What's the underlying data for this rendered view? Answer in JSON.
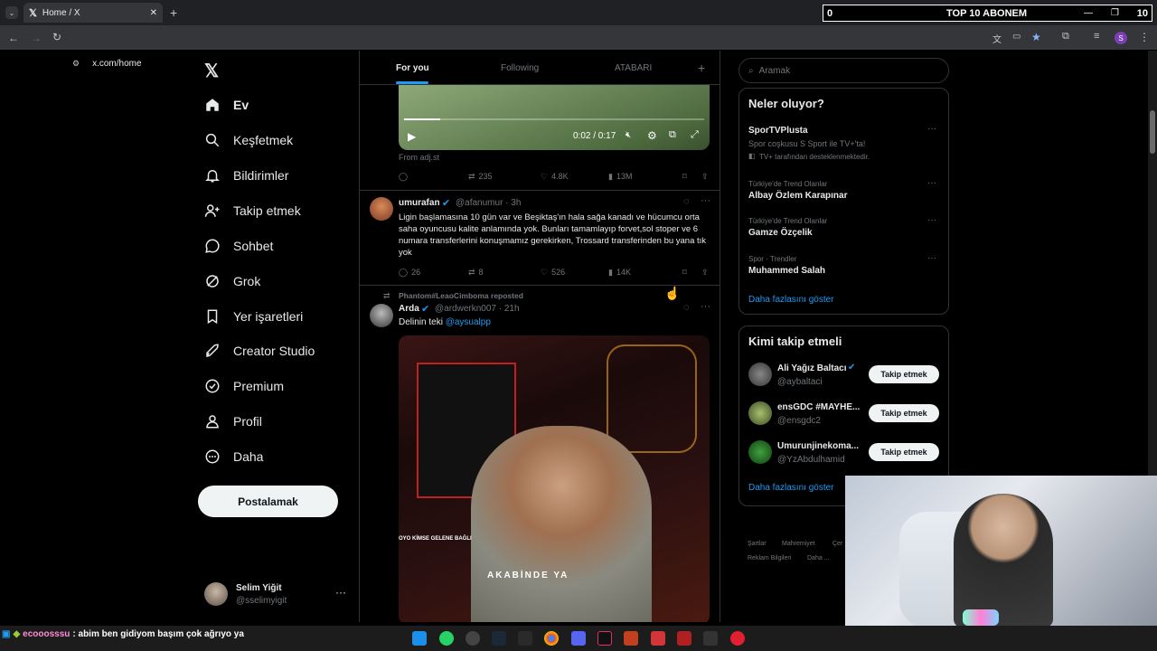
{
  "browser": {
    "tab_title": "Home / X",
    "url": "x.com/home",
    "profile_initial": "S"
  },
  "overlay": {
    "left_count": "0",
    "title": "TOP 10 ABONEM",
    "right_count": "10"
  },
  "nav": {
    "items": [
      {
        "label": "Ev"
      },
      {
        "label": "Keşfetmek"
      },
      {
        "label": "Bildirimler"
      },
      {
        "label": "Takip etmek"
      },
      {
        "label": "Sohbet"
      },
      {
        "label": "Grok"
      },
      {
        "label": "Yer işaretleri"
      },
      {
        "label": "Creator Studio"
      },
      {
        "label": "Premium"
      },
      {
        "label": "Profil"
      },
      {
        "label": "Daha"
      }
    ],
    "post_button": "Postalamak",
    "account": {
      "name": "Selim Yiğit",
      "handle": "@sselimyigit"
    }
  },
  "timeline": {
    "tabs": [
      "For you",
      "Following",
      "ATABARI"
    ],
    "video": {
      "time": "0:02 / 0:17",
      "source": "From adj.st"
    },
    "post0_stats": {
      "reposts": "235",
      "likes": "4.8K",
      "views": "13M"
    },
    "post1": {
      "name": "umurafan",
      "handle": "@afanumur · 3h",
      "text": "Ligin başlamasına 10 gün var ve Beşiktaş'ın hala sağa kanadı ve hücumcu orta saha oyuncusu kalite anlamında yok. Bunları tamamlayıp forvet,sol stoper ve 6 numara transferlerini konuşmamız gerekirken, Trossard transferinden bu yana tık yok",
      "replies": "26",
      "reposts": "8",
      "likes": "526",
      "views": "14K"
    },
    "post2": {
      "repost_label": "Phantom#LeaoCimboma reposted",
      "name": "Arda",
      "handle": "@ardwerkn007 · 21h",
      "text_prefix": "Delinin teki ",
      "mention": "@aysualpp",
      "video_caption1": "OYO KİMSE GELENE BAĞLI",
      "video_caption2": "AKABİNDE YA"
    }
  },
  "sidebar": {
    "search_placeholder": "Aramak",
    "trends_title": "Neler oluyor?",
    "trends": [
      {
        "name": "SporTVPlusta",
        "desc": "Spor coşkusu S Sport ile TV+'ta!",
        "sub": "TV+ tarafından desteklenmektedir."
      },
      {
        "context": "Türkiye'de Trend Olanlar",
        "name": "Albay Özlem Karapınar"
      },
      {
        "context": "Türkiye'de Trend Olanlar",
        "name": "Gamze Özçelik"
      },
      {
        "context": "Spor · Trendler",
        "name": "Muhammed Salah"
      }
    ],
    "show_more": "Daha fazlasını göster",
    "follow_title": "Kimi takip etmeli",
    "follow": [
      {
        "name": "Ali Yağız Baltacı",
        "handle": "@aybaltaci",
        "button": "Takip etmek"
      },
      {
        "name": "ensGDC #MAYHE...",
        "handle": "@ensgdc2",
        "button": "Takip etmek"
      },
      {
        "name": "Umurunjinekoma...",
        "handle": "@YzAbdulhamid",
        "button": "Takip etmek"
      }
    ],
    "follow_more": "Daha fazlasını göster",
    "footer": [
      "Şartlar",
      "Mahremiyet",
      "Çer",
      "Reklam Bilgileri",
      "Daha ..."
    ]
  },
  "chat": {
    "user": "ecooosssu",
    "message": ": abim ben gidiyom başım çok ağrıyo ya"
  },
  "colors": {
    "accent": "#1d9bf0",
    "background": "#000000",
    "border": "#2f3336"
  }
}
